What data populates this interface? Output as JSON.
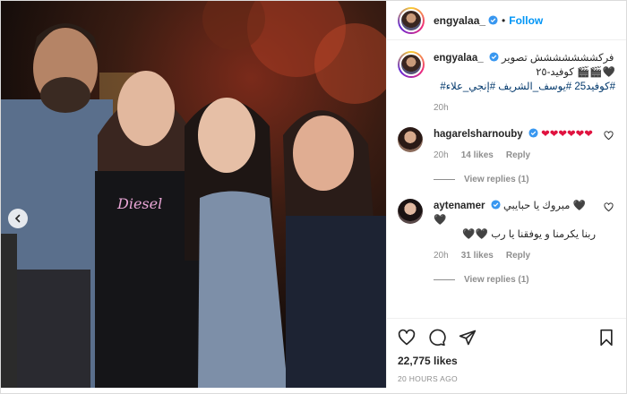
{
  "header": {
    "username": "engyalaa_",
    "separator": "•",
    "follow_label": "Follow"
  },
  "caption": {
    "username": "engyalaa_",
    "line1": "فركششششششش تصوير",
    "line2": "🖤🎬🎬 كوفيد-٢٥",
    "hashtags": "#كوفيد25 #يوسف_الشريف #إنجي_علاء#",
    "time": "20h"
  },
  "comments": [
    {
      "username": "hagarelsharnouby",
      "text": "❤❤❤❤❤❤",
      "time": "20h",
      "likes": "14 likes",
      "reply_label": "Reply",
      "view_replies": "View replies (1)"
    },
    {
      "username": "aytenamer",
      "text_line1": "مبروك يا حبايبي 🖤🖤",
      "text_line2": "ربنا يكرمنا و يوفقنا يا رب 🖤🖤",
      "time": "20h",
      "likes": "31 likes",
      "reply_label": "Reply",
      "view_replies": "View replies (1)"
    }
  ],
  "actions": {
    "likes_count": "22,775 likes",
    "posted_ago": "20 HOURS AGO"
  },
  "icons": {
    "verified": "verified-badge-icon",
    "carousel_prev": "chevron-left-icon",
    "like": "heart-icon",
    "comment": "comment-icon",
    "share": "paper-plane-icon",
    "save": "bookmark-icon"
  },
  "colors": {
    "accent": "#0095f6",
    "heart": "#e0123f",
    "hashtag": "#00376b",
    "muted": "#8e8e8e"
  }
}
